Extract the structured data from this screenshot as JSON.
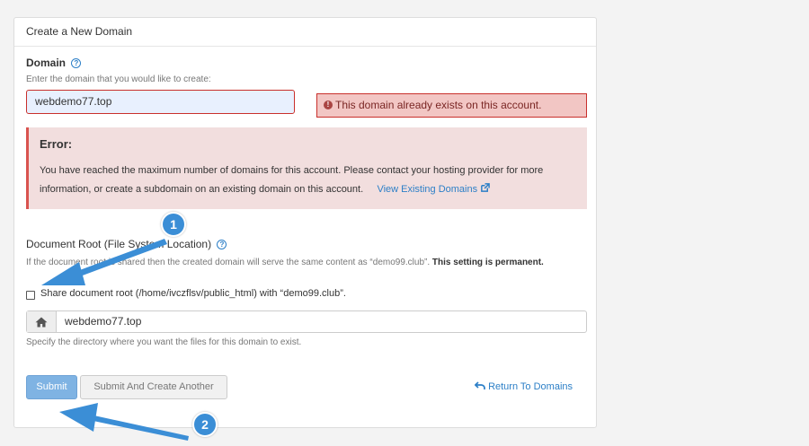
{
  "panel": {
    "title": "Create a New Domain"
  },
  "domain": {
    "label": "Domain",
    "help_glyph": "?",
    "hint": "Enter the domain that you would like to create:",
    "value": "webdemo77.top",
    "inline_error": "This domain already exists on this account.",
    "error_glyph": "!"
  },
  "alert": {
    "title": "Error:",
    "text": "You have reached the maximum number of domains for this account. Please contact your hosting provider for more information, or create a subdomain on an existing domain on this account.",
    "link": "View Existing Domains"
  },
  "docroot": {
    "label": "Document Root (File System Location)",
    "help_glyph": "?",
    "note_prefix": "If the document root is shared then the created domain will serve the same content as “demo99.club”.",
    "note_bold": "This setting is permanent.",
    "checkbox_label": "Share document root (/home/ivczflsv/public_html) with “demo99.club”.",
    "path_value": "webdemo77.top",
    "path_hint": "Specify the directory where you want the files for this domain to exist."
  },
  "actions": {
    "submit": "Submit",
    "submit_another": "Submit And Create Another",
    "return": "Return To Domains"
  },
  "annotations": {
    "step1": "1",
    "step2": "2"
  },
  "colors": {
    "accent": "#2c7fc7",
    "error_border": "#c9302c",
    "alert_bg": "#f2dede",
    "primary_button": "#7fb3e3",
    "annotation": "#3b8ed6"
  },
  "icons": [
    "help-icon",
    "error-icon",
    "external-link-icon",
    "home-icon",
    "return-arrow-icon"
  ]
}
